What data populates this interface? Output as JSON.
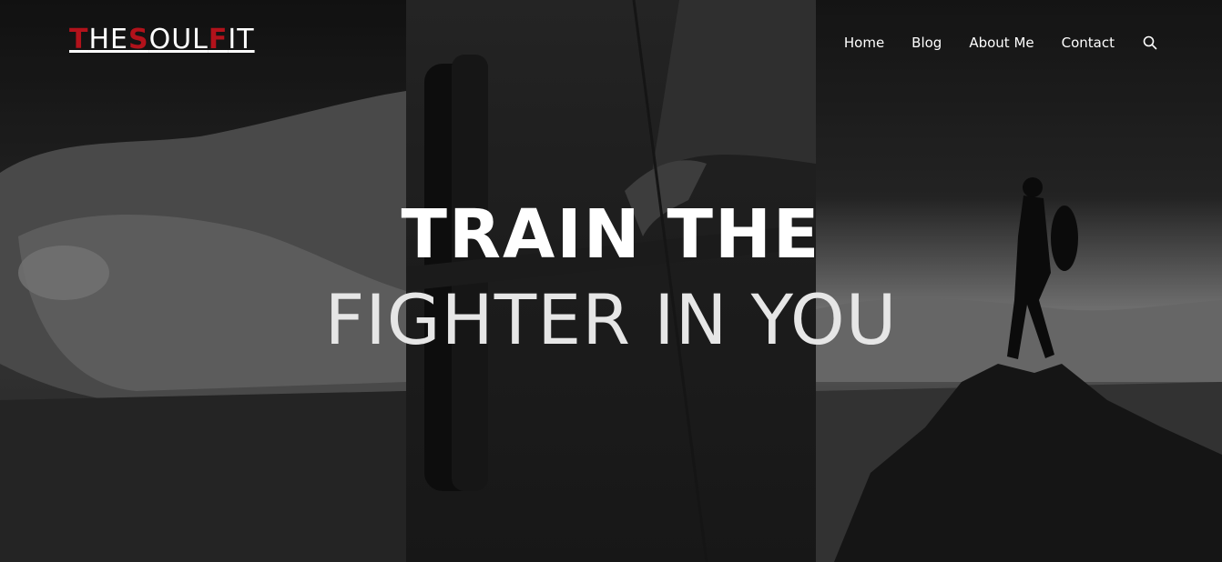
{
  "brand": {
    "logo_parts": [
      "T",
      "HE",
      "S",
      "OUL",
      "F",
      "IT"
    ],
    "accent_color": "#b2121b"
  },
  "nav": {
    "items": [
      "Home",
      "Blog",
      "About Me",
      "Contact"
    ],
    "search_icon": "search-icon"
  },
  "hero": {
    "line1": "TRAIN THE",
    "line2": "FIGHTER IN YOU"
  }
}
